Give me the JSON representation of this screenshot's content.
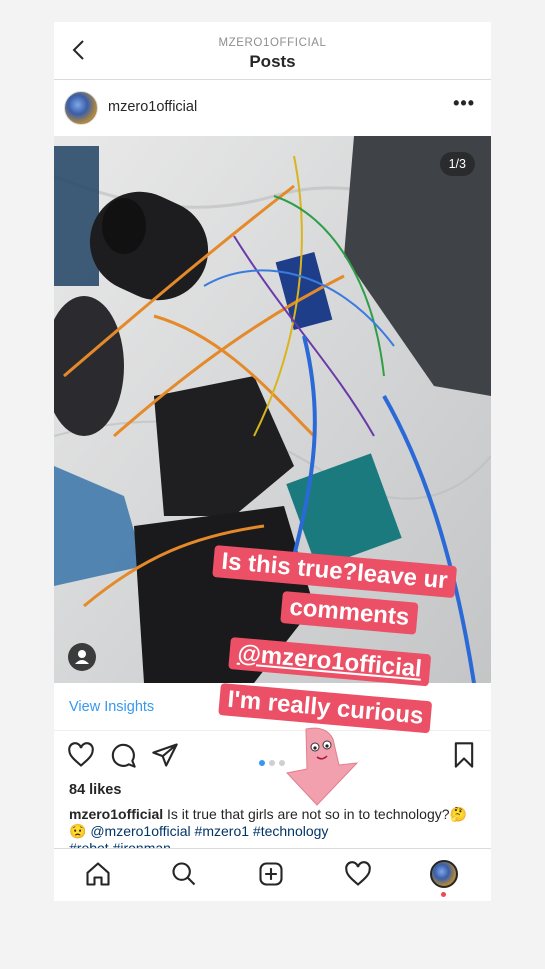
{
  "header": {
    "account_label": "MZERO1OFFICIAL",
    "title": "Posts",
    "back_icon": "chevron-left-icon"
  },
  "post": {
    "username": "mzero1official",
    "more_icon": "more-horizontal-icon",
    "image_counter": "1/3",
    "view_insights_label": "View Insights",
    "likes": "84 likes",
    "caption": {
      "username": "mzero1official",
      "text": "Is it true that girls are not so in to technology?",
      "emojis": "🤔😟",
      "mention": "@mzero1official",
      "hashtags": "#mzero1 #technology",
      "hashtags_line2": "#robot #ironman"
    },
    "carousel": {
      "count": 3,
      "active": 0
    }
  },
  "sticker": {
    "lines": [
      "Is this true?leave ur",
      "comments",
      "@mzero1official",
      "I'm really curious"
    ],
    "accent": "#eb5066"
  },
  "tabbar": {
    "icons": [
      "home-icon",
      "search-icon",
      "add-post-icon",
      "activity-heart-icon",
      "profile-avatar"
    ]
  },
  "colors": {
    "link": "#3897f0",
    "mention": "#003569",
    "notification": "#ed4956"
  }
}
